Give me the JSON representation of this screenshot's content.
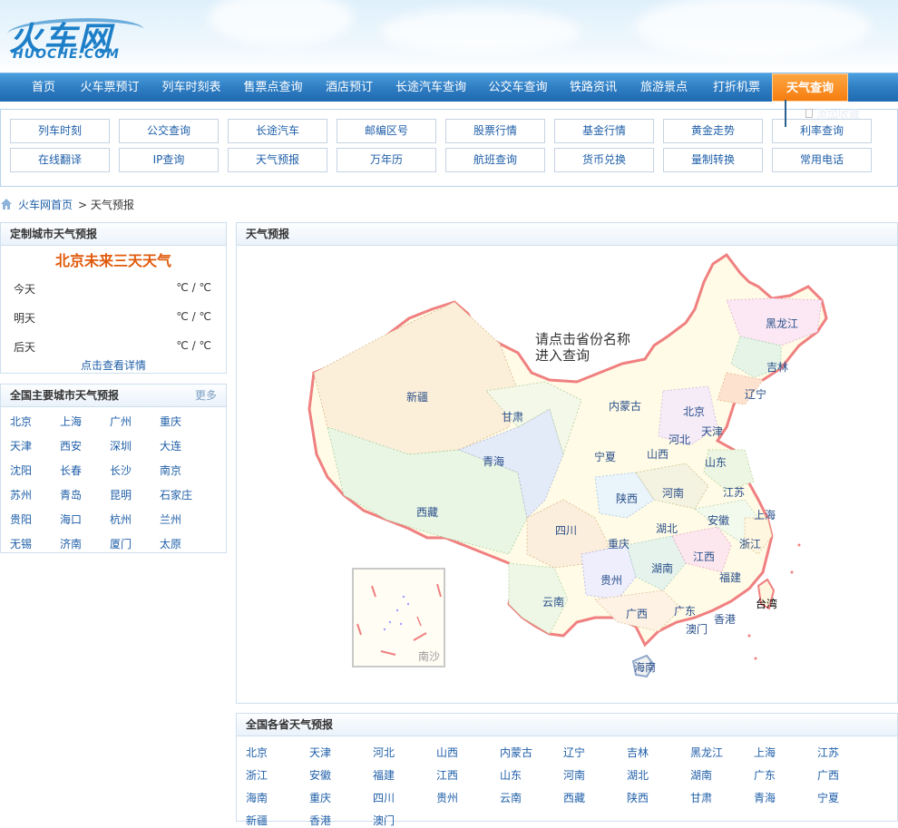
{
  "logo": {
    "main": "火车网",
    "sub": "HUOCHE.COM"
  },
  "nav": [
    {
      "label": "首页"
    },
    {
      "label": "火车票预订"
    },
    {
      "label": "列车时刻表"
    },
    {
      "label": "售票点查询"
    },
    {
      "label": "酒店预订"
    },
    {
      "label": "长途汽车查询"
    },
    {
      "label": "公交车查询"
    },
    {
      "label": "铁路资讯"
    },
    {
      "label": "旅游景点"
    },
    {
      "label": "打折机票"
    },
    {
      "label": "天气查询"
    }
  ],
  "nav_active_color": "#f57d10",
  "tooltip": {
    "text": "添加收藏"
  },
  "tools": {
    "row1": [
      "列车时刻",
      "公交查询",
      "长途汽车",
      "邮编区号",
      "股票行情",
      "基金行情",
      "黄金走势",
      "利率查询"
    ],
    "row2": [
      "在线翻译",
      "IP查询",
      "天气预报",
      "万年历",
      "航班查询",
      "货币兑换",
      "量制转换",
      "常用电话"
    ]
  },
  "breadcrumb": {
    "home": "火车网首页",
    "current": "> 天气预报"
  },
  "custom_city": {
    "head": "定制城市天气预报",
    "title": "北京未来三天天气",
    "days": [
      {
        "label": "今天",
        "temp": "℃ / ℃"
      },
      {
        "label": "明天",
        "temp": "℃ / ℃"
      },
      {
        "label": "后天",
        "temp": "℃ / ℃"
      }
    ],
    "detail_link": "点击查看详情"
  },
  "major_cities": {
    "head": "全国主要城市天气预报",
    "more": "更多",
    "cities": [
      "北京",
      "上海",
      "广州",
      "重庆",
      "天津",
      "西安",
      "深圳",
      "大连",
      "沈阳",
      "长春",
      "长沙",
      "南京",
      "苏州",
      "青岛",
      "昆明",
      "石家庄",
      "贵阳",
      "海口",
      "杭州",
      "兰州",
      "无锡",
      "济南",
      "厦门",
      "太原"
    ]
  },
  "map_panel": {
    "head": "天气预报",
    "hint_line1": "请点击省份名称",
    "hint_line2": "进入查询",
    "nansha": "南沙",
    "provinces": [
      "黑龙江",
      "吉林",
      "辽宁",
      "内蒙古",
      "北京",
      "天津",
      "河北",
      "山西",
      "山东",
      "新疆",
      "甘肃",
      "宁夏",
      "青海",
      "陕西",
      "河南",
      "江苏",
      "上海",
      "安徽",
      "西藏",
      "四川",
      "重庆",
      "湖北",
      "浙江",
      "江西",
      "贵州",
      "湖南",
      "福建",
      "云南",
      "台湾",
      "广西",
      "广东",
      "澳门",
      "香港",
      "海南"
    ]
  },
  "provinces_panel": {
    "head": "全国各省天气预报",
    "items": [
      "北京",
      "天津",
      "河北",
      "山西",
      "内蒙古",
      "辽宁",
      "吉林",
      "黑龙江",
      "上海",
      "江苏",
      "浙江",
      "安徽",
      "福建",
      "江西",
      "山东",
      "河南",
      "湖北",
      "湖南",
      "广东",
      "广西",
      "海南",
      "重庆",
      "四川",
      "贵州",
      "云南",
      "西藏",
      "陕西",
      "甘肃",
      "青海",
      "宁夏",
      "新疆",
      "香港",
      "澳门"
    ]
  }
}
